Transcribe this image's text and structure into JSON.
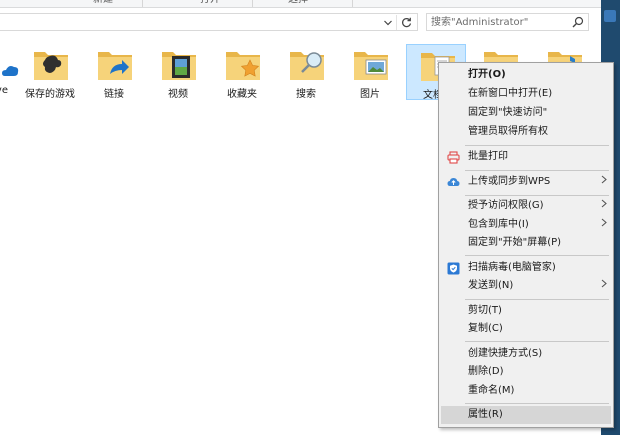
{
  "ribbon": {
    "groups": [
      "新建",
      "打开",
      "选择"
    ]
  },
  "address": {
    "search_placeholder": "搜索\"Administrator\""
  },
  "files": [
    {
      "label": "ve"
    },
    {
      "label": "保存的游戏"
    },
    {
      "label": "链接"
    },
    {
      "label": "视频"
    },
    {
      "label": "收藏夹"
    },
    {
      "label": "搜索"
    },
    {
      "label": "图片"
    },
    {
      "label": "文档"
    }
  ],
  "context_menu": {
    "open": "打开(O)",
    "open_new_window": "在新窗口中打开(E)",
    "pin_quick_access": "固定到\"快速访问\"",
    "take_ownership": "管理员取得所有权",
    "batch_print": "批量打印",
    "upload_wps": "上传或同步到WPS",
    "grant_access": "授予访问权限(G)",
    "include_library": "包含到库中(I)",
    "pin_start": "固定到\"开始\"屏幕(P)",
    "scan_virus": "扫描病毒(电脑管家)",
    "send_to": "发送到(N)",
    "cut": "剪切(T)",
    "copy": "复制(C)",
    "create_shortcut": "创建快捷方式(S)",
    "delete": "删除(D)",
    "rename": "重命名(M)",
    "properties": "属性(R)"
  },
  "colors": {
    "folder": "#f2c94c",
    "selection": "#cce8ff",
    "menu_bg": "#f0f0f0",
    "highlight": "#d6d6d6"
  }
}
